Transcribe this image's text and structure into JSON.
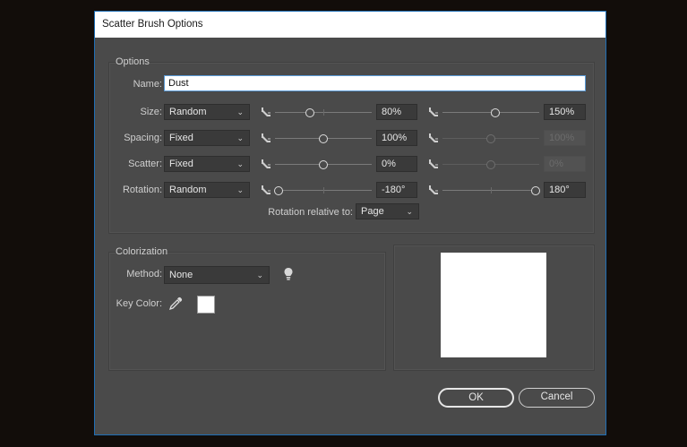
{
  "title": "Scatter Brush Options",
  "options": {
    "group_label": "Options",
    "name_label": "Name:",
    "name_value": "Dust",
    "rows": [
      {
        "label": "Size:",
        "mode": "Random",
        "min_value": "80%",
        "max_value": "150%",
        "min_level": 0.35,
        "max_level": 0.55,
        "second_enabled": true
      },
      {
        "label": "Spacing:",
        "mode": "Fixed",
        "min_value": "100%",
        "max_value": "100%",
        "min_level": 0.5,
        "max_level": 0.5,
        "second_enabled": false
      },
      {
        "label": "Scatter:",
        "mode": "Fixed",
        "min_value": "0%",
        "max_value": "0%",
        "min_level": 0.5,
        "max_level": 0.5,
        "second_enabled": false
      },
      {
        "label": "Rotation:",
        "mode": "Random",
        "min_value": "-180°",
        "max_value": "180°",
        "min_level": 0.0,
        "max_level": 1.0,
        "second_enabled": true
      }
    ],
    "rotation_relative_label": "Rotation relative to:",
    "rotation_relative_value": "Page"
  },
  "colorization": {
    "group_label": "Colorization",
    "method_label": "Method:",
    "method_value": "None",
    "key_color_label": "Key Color:",
    "key_color": "#ffffff"
  },
  "buttons": {
    "ok": "OK",
    "cancel": "Cancel"
  },
  "icons": {
    "mode_icon": "pressure-mode-icon",
    "tip_icon": "lightbulb-icon",
    "eyedropper_icon": "eyedropper-icon",
    "dropdown_icon": "chevron-down-icon"
  },
  "colors": {
    "accent": "#1f6fb6",
    "dialog_bg": "#4a4a4a"
  }
}
